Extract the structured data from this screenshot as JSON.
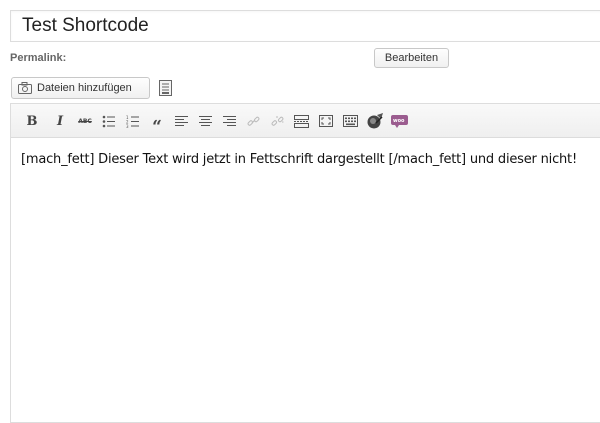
{
  "post": {
    "title": "Test Shortcode",
    "permalink_label": "Permalink:",
    "edit_button": "Bearbeiten"
  },
  "media": {
    "add_media_label": "Dateien hinzufügen"
  },
  "toolbar": {
    "bold": "B",
    "italic": "I",
    "strike": "ABC",
    "blockquote": "“",
    "icons": [
      "bold-icon",
      "italic-icon",
      "strikethrough-icon",
      "bullet-list-icon",
      "numbered-list-icon",
      "blockquote-icon",
      "align-left-icon",
      "align-center-icon",
      "align-right-icon",
      "link-icon",
      "unlink-icon",
      "more-tag-icon",
      "fullscreen-icon",
      "kitchen-sink-icon",
      "spellcheck-icon",
      "woocommerce-icon"
    ]
  },
  "editor": {
    "content": "[mach_fett] Dieser Text wird jetzt in Fettschrift dargestellt [/mach_fett] und dieser nicht!"
  },
  "colors": {
    "woo_purple": "#9b5c8f",
    "border": "#dddddd"
  }
}
